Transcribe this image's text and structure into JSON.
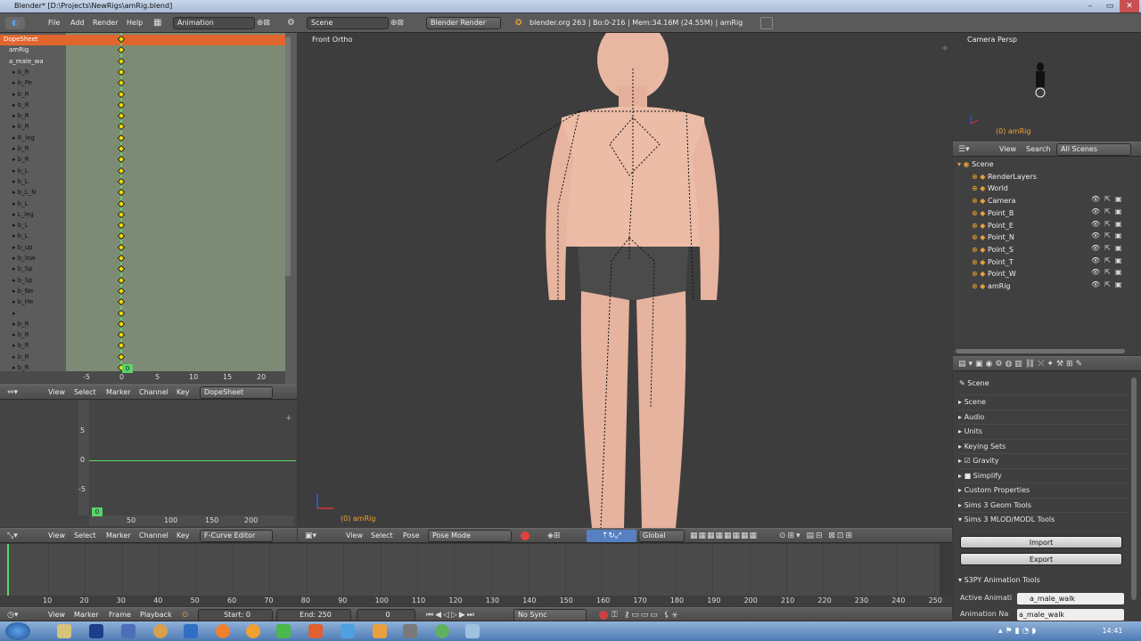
{
  "window": {
    "title": "Blender* [D:\\Projects\\NewRigs\\amRig.blend]"
  },
  "info": {
    "menus": [
      "File",
      "Add",
      "Render",
      "Help"
    ],
    "layout": "Animation",
    "scene": "Scene",
    "engine": "Blender Render",
    "stats": "blender.org 263 | Bo:0-216 | Mem:34.16M (24.55M) | amRig"
  },
  "dopesheet": {
    "rows": [
      {
        "label": "DopeSheet",
        "kind": "summary"
      },
      {
        "label": "amRig",
        "kind": "object"
      },
      {
        "label": "a_male_wa",
        "kind": "action"
      },
      {
        "label": "b_R"
      },
      {
        "label": "b_Pe"
      },
      {
        "label": "b_R"
      },
      {
        "label": "b_R"
      },
      {
        "label": "b_R"
      },
      {
        "label": "b_R"
      },
      {
        "label": "R_leg"
      },
      {
        "label": "b_R"
      },
      {
        "label": "b_R"
      },
      {
        "label": "b_L"
      },
      {
        "label": "b_L"
      },
      {
        "label": "b_L_N"
      },
      {
        "label": "b_L"
      },
      {
        "label": "L_leg"
      },
      {
        "label": "b_L"
      },
      {
        "label": "b_L"
      },
      {
        "label": "b_up"
      },
      {
        "label": "b_low"
      },
      {
        "label": "b_Sp"
      },
      {
        "label": "b_Sp"
      },
      {
        "label": "b_Ne"
      },
      {
        "label": "b_He"
      },
      {
        "label": ""
      },
      {
        "label": "b_R"
      },
      {
        "label": "b_R"
      },
      {
        "label": "b_R"
      },
      {
        "label": "b_R"
      },
      {
        "label": "b_R"
      }
    ],
    "ruler": [
      "-5",
      "0",
      "5",
      "10",
      "15",
      "20"
    ],
    "current_frame": "0",
    "menus": [
      "View",
      "Select",
      "Marker",
      "Channel",
      "Key"
    ],
    "mode": "DopeSheet"
  },
  "graph": {
    "yticks": [
      "5",
      "0",
      "-5"
    ],
    "xticks": [
      "50",
      "100",
      "150",
      "200"
    ],
    "current_frame": "0",
    "menus": [
      "View",
      "Select",
      "Marker",
      "Channel",
      "Key"
    ],
    "mode": "F-Curve Editor"
  },
  "viewport": {
    "label": "Front Ortho",
    "object_label": "(0) amRig",
    "menus": [
      "View",
      "Select",
      "Pose"
    ],
    "mode": "Pose Mode",
    "orientation": "Global"
  },
  "camera_view": {
    "label": "Camera Persp",
    "object_label": "(0) amRig"
  },
  "outliner": {
    "menus": [
      "View",
      "Search"
    ],
    "filter": "All Scenes",
    "items": [
      {
        "label": "Scene",
        "indent": 0
      },
      {
        "label": "RenderLayers",
        "indent": 1
      },
      {
        "label": "World",
        "indent": 1
      },
      {
        "label": "Camera",
        "indent": 1
      },
      {
        "label": "Point_B",
        "indent": 1
      },
      {
        "label": "Point_E",
        "indent": 1
      },
      {
        "label": "Point_N",
        "indent": 1
      },
      {
        "label": "Point_S",
        "indent": 1
      },
      {
        "label": "Point_T",
        "indent": 1
      },
      {
        "label": "Point_W",
        "indent": 1
      },
      {
        "label": "amRig",
        "indent": 1
      }
    ]
  },
  "properties": {
    "context": "Scene",
    "panels": [
      {
        "label": "Scene",
        "open": false
      },
      {
        "label": "Audio",
        "open": false
      },
      {
        "label": "Units",
        "open": false
      },
      {
        "label": "Keying Sets",
        "open": false
      },
      {
        "label": "Gravity",
        "open": false,
        "checkbox": true
      },
      {
        "label": "Simplify",
        "open": false,
        "checkbox": false
      },
      {
        "label": "Custom Properties",
        "open": false
      },
      {
        "label": "Sims 3 Geom Tools",
        "open": false
      },
      {
        "label": "Sims 3 MLOD/MODL Tools",
        "open": true
      }
    ],
    "buttons": [
      "Import",
      "Export"
    ],
    "anim_panel": "S3PY Animation Tools",
    "fields": [
      {
        "label": "Active Animati",
        "value": "a_male_walk"
      },
      {
        "label": "Animation Na",
        "value": "a_male_walk"
      }
    ]
  },
  "timeline": {
    "ticks": [
      "10",
      "20",
      "30",
      "40",
      "50",
      "60",
      "70",
      "80",
      "90",
      "100",
      "110",
      "120",
      "130",
      "140",
      "150",
      "160",
      "170",
      "180",
      "190",
      "200",
      "210",
      "220",
      "230",
      "240",
      "250"
    ],
    "menus": [
      "View",
      "Marker",
      "Frame",
      "Playback"
    ],
    "start": "Start: 0",
    "end": "End: 250",
    "current": "0",
    "sync": "No Sync"
  },
  "clock": "14:41",
  "colors": {
    "keyframe": "#f0e000",
    "accent": "#5680c2",
    "active_header": "#e0662e",
    "frame_marker": "#7fe07f"
  }
}
